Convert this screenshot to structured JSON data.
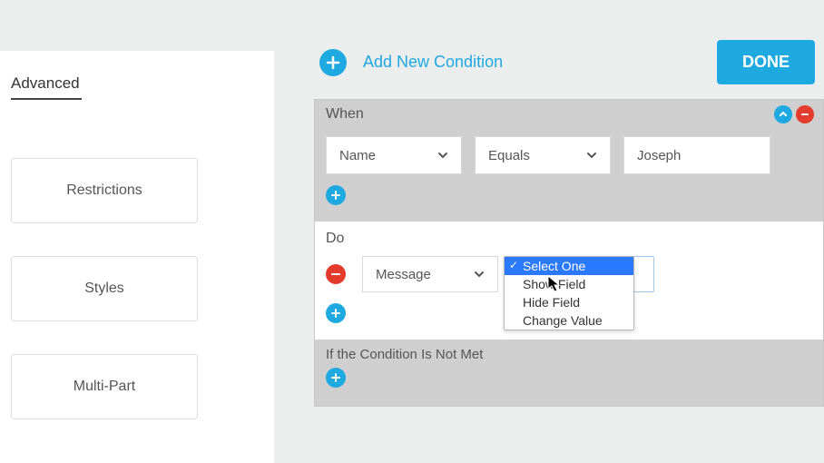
{
  "sidebar": {
    "tab": "Advanced",
    "items": [
      "Restrictions",
      "Styles",
      "Multi-Part"
    ]
  },
  "top": {
    "add_label": "Add New Condition",
    "done": "DONE"
  },
  "condition": {
    "when_title": "When",
    "field": "Name",
    "operator": "Equals",
    "value": "Joseph",
    "do_title": "Do",
    "do_select": "Message",
    "dropdown": [
      "Select One",
      "Show Field",
      "Hide Field",
      "Change Value"
    ],
    "dropdown_selected": 0,
    "else_title": "If the Condition Is Not Met"
  }
}
